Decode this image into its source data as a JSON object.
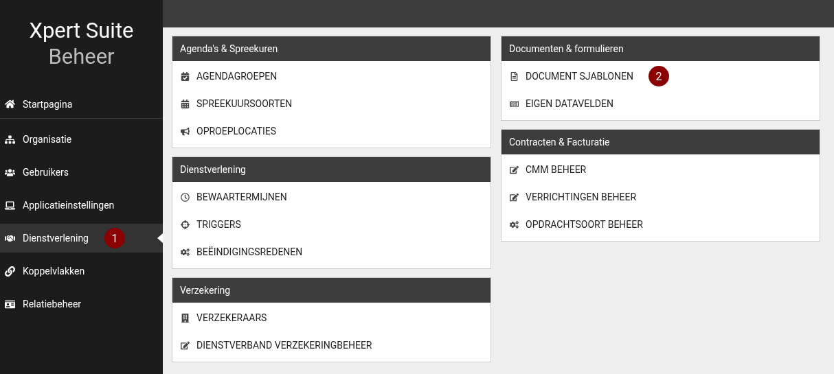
{
  "sidebar": {
    "title": "Xpert Suite",
    "subtitle": "Beheer",
    "items": [
      {
        "label": "Startpagina",
        "selected": false
      },
      {
        "label": "Organisatie",
        "selected": false
      },
      {
        "label": "Gebruikers",
        "selected": false
      },
      {
        "label": "Applicatieinstellingen",
        "selected": false
      },
      {
        "label": "Dienstverlening",
        "selected": true,
        "badge": "1"
      },
      {
        "label": "Koppelvlakken",
        "selected": false
      },
      {
        "label": "Relatiebeheer",
        "selected": false
      }
    ]
  },
  "columns": [
    [
      {
        "title": "Agenda's & Spreekuren",
        "items": [
          {
            "label": "AGENDAGROEPEN"
          },
          {
            "label": "SPREEKUURSOORTEN"
          },
          {
            "label": "OPROEPLOCATIES"
          }
        ]
      },
      {
        "title": "Dienstverlening",
        "items": [
          {
            "label": "BEWAARTERMIJNEN"
          },
          {
            "label": "TRIGGERS"
          },
          {
            "label": "BEËINDIGINGSREDENEN"
          }
        ]
      },
      {
        "title": "Verzekering",
        "items": [
          {
            "label": "VERZEKERAARS"
          },
          {
            "label": "DIENSTVERBAND VERZEKERINGBEHEER"
          }
        ]
      }
    ],
    [
      {
        "title": "Documenten & formulieren",
        "items": [
          {
            "label": "DOCUMENT SJABLONEN",
            "badge": "2"
          },
          {
            "label": "EIGEN DATAVELDEN"
          }
        ]
      },
      {
        "title": "Contracten & Facturatie",
        "items": [
          {
            "label": "CMM BEHEER"
          },
          {
            "label": "VERRICHTINGEN BEHEER"
          },
          {
            "label": "OPDRACHTSOORT BEHEER"
          }
        ]
      }
    ]
  ]
}
